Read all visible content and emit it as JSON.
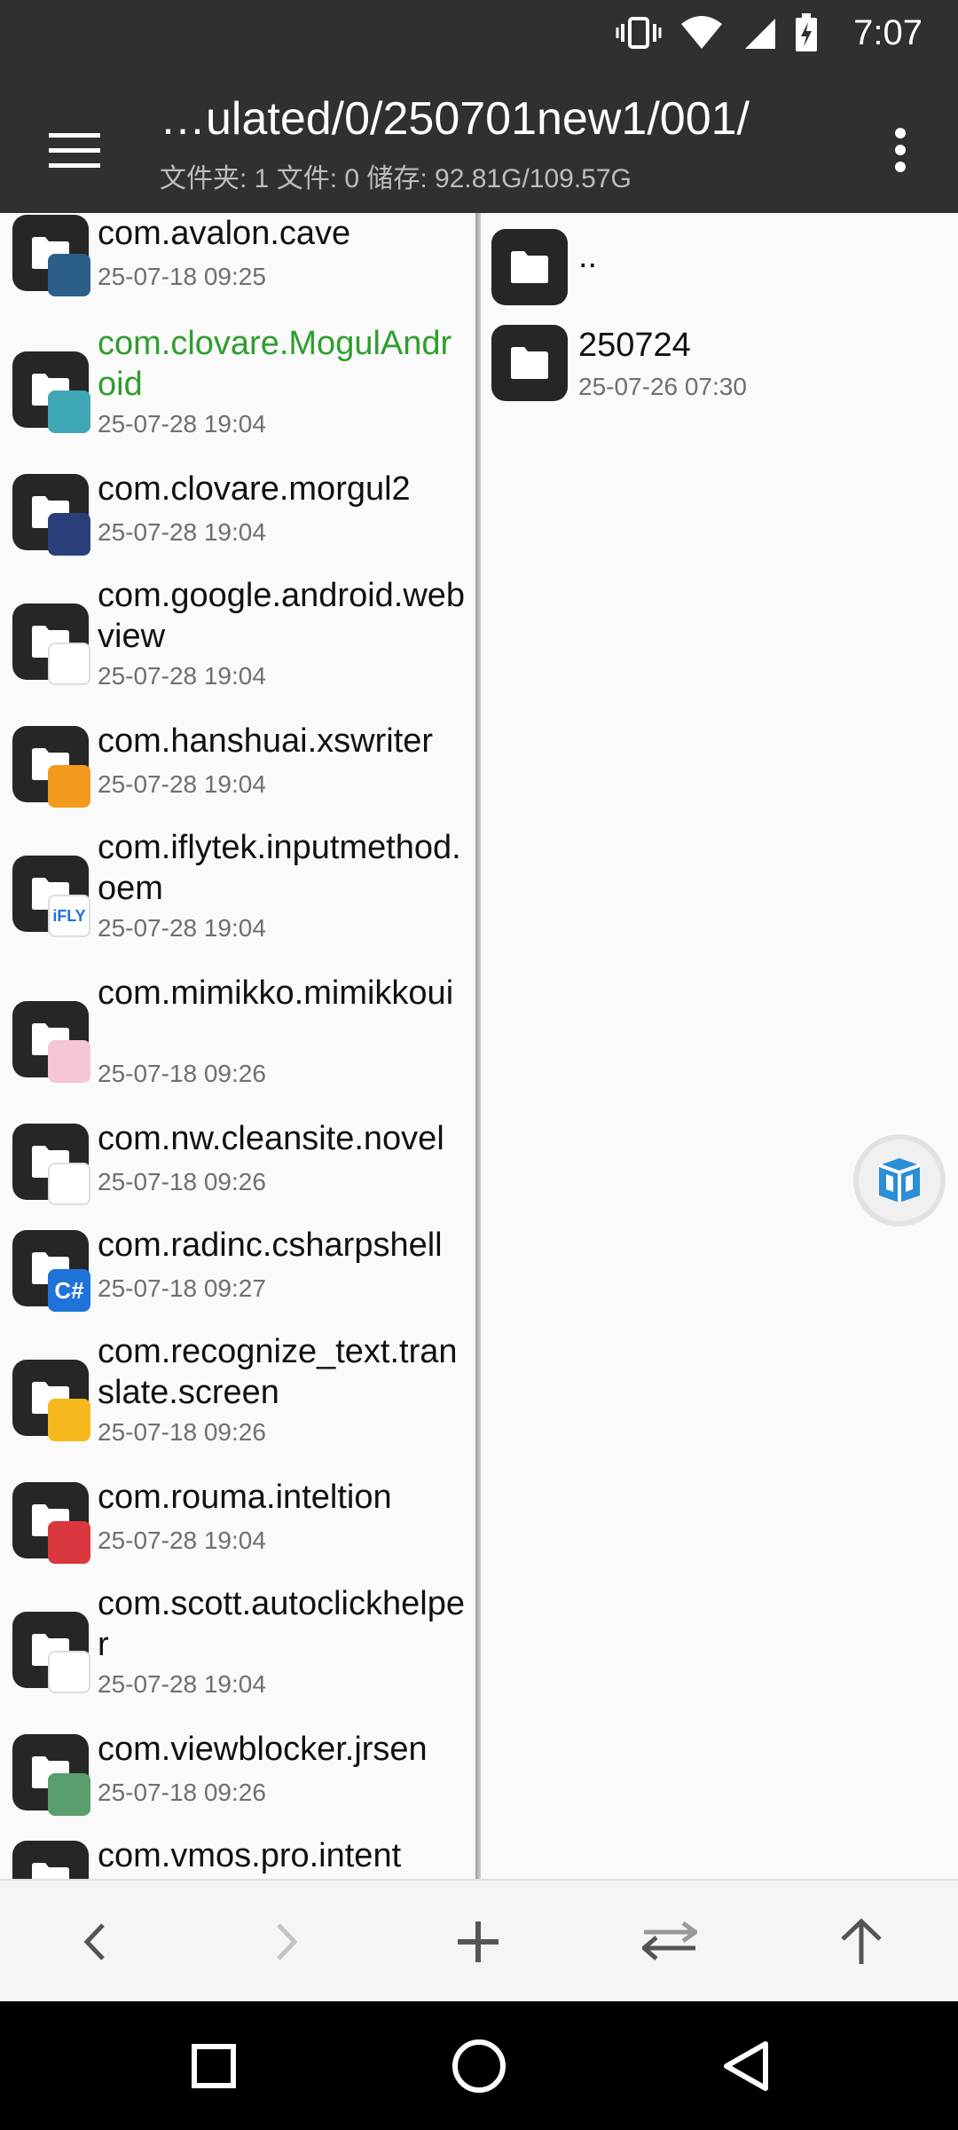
{
  "status_bar": {
    "time": "7:07",
    "icons": [
      "vibrate-icon",
      "wifi-icon",
      "signal-icon",
      "battery-charging-icon"
    ]
  },
  "toolbar": {
    "title": "…ulated/0/250701new1/001/",
    "subtitle": "文件夹: 1  文件: 0  储存: 92.81G/109.57G",
    "menu_icon": "hamburger-menu-icon",
    "overflow_icon": "more-vert-icon"
  },
  "left_list": [
    {
      "name": "com.avalon.cave",
      "date": "25-07-18 09:25",
      "badge": "avalon-app-icon",
      "badge_color": "#2b5f8a",
      "highlight": false
    },
    {
      "name": "com.clovare.MogulAndroid",
      "date": "25-07-28 19:04",
      "badge": "mogul-app-icon",
      "badge_color": "#3fa7b5",
      "highlight": true,
      "highlight_color": "#2e9e2e"
    },
    {
      "name": "com.clovare.morgul2",
      "date": "25-07-28 19:04",
      "badge": "morgul-app-icon",
      "badge_color": "#2a3f7a",
      "highlight": false
    },
    {
      "name": "com.google.android.webview",
      "date": "25-07-28 19:04",
      "badge": "webview-gear-icon",
      "badge_color": "#ffffff",
      "highlight": false
    },
    {
      "name": "com.hanshuai.xswriter",
      "date": "25-07-28 19:04",
      "badge": "xswriter-app-icon",
      "badge_color": "#f39a1e",
      "highlight": false
    },
    {
      "name": "com.iflytek.inputmethod.oem",
      "date": "25-07-28 19:04",
      "badge": "iflytek-app-icon",
      "badge_color": "#ffffff",
      "badge_text": "iFLY",
      "highlight": false
    },
    {
      "name": "com.mimikko.mimikkoui",
      "date": "25-07-18 09:26",
      "badge": "mimikko-app-icon",
      "badge_color": "#f4c6d6",
      "highlight": false
    },
    {
      "name": "com.nw.cleansite.novel",
      "date": "25-07-18 09:26",
      "badge": "novel-app-icon",
      "badge_color": "#ffffff",
      "highlight": false
    },
    {
      "name": "com.radinc.csharpshell",
      "date": "25-07-18 09:27",
      "badge": "csharp-app-icon",
      "badge_color": "#1e73d8",
      "badge_text": "C#",
      "highlight": false
    },
    {
      "name": "com.recognize_text.translate.screen",
      "date": "25-07-18 09:26",
      "badge": "translate-app-icon",
      "badge_color": "#f5b81c",
      "highlight": false
    },
    {
      "name": "com.rouma.inteltion",
      "date": "25-07-28 19:04",
      "badge": "play-app-icon",
      "badge_color": "#d9373d",
      "highlight": false
    },
    {
      "name": "com.scott.autoclickhelper",
      "date": "25-07-28 19:04",
      "badge": "autoclick-app-icon",
      "badge_color": "#ffffff",
      "highlight": false
    },
    {
      "name": "com.viewblocker.jrsen",
      "date": "25-07-18 09:26",
      "badge": "viewblocker-app-icon",
      "badge_color": "#5a9e6e",
      "highlight": false
    },
    {
      "name": "com.vmos.pro.intent",
      "date": "",
      "badge": "",
      "badge_color": "#262626",
      "highlight": false
    }
  ],
  "right_list": [
    {
      "name": "..",
      "date": ""
    },
    {
      "name": "250724",
      "date": "25-07-26 07:30"
    }
  ],
  "float_button": {
    "icon": "cube-icon",
    "color": "#2b8fd6"
  },
  "action_bar": {
    "buttons": [
      "back-arrow-icon",
      "forward-arrow-icon",
      "add-icon",
      "swap-icon",
      "up-arrow-icon"
    ]
  },
  "nav_bar": {
    "buttons": [
      "recents-icon",
      "home-icon",
      "back-icon"
    ]
  }
}
